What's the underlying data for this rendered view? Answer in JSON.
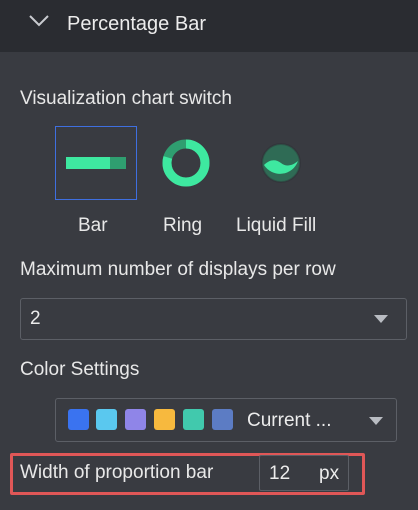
{
  "header": {
    "title": "Percentage Bar",
    "collapse_icon": "chevron-down-icon"
  },
  "chart_switch": {
    "label": "Visualization chart switch",
    "options": [
      {
        "label": "Bar",
        "icon": "bar-chart-icon",
        "selected": true
      },
      {
        "label": "Ring",
        "icon": "ring-chart-icon",
        "selected": false
      },
      {
        "label": "Liquid Fill",
        "icon": "liquid-fill-icon",
        "selected": false
      }
    ]
  },
  "max_displays": {
    "label": "Maximum number of displays per row",
    "value": "2"
  },
  "color_settings": {
    "label": "Color Settings",
    "palette": [
      "#3a73f0",
      "#5ac8ef",
      "#8f85e8",
      "#f7b93e",
      "#41c9ad",
      "#5c7cc4"
    ],
    "selected_value": "Current ..."
  },
  "bar_width": {
    "label": "Width of proportion bar",
    "value": "12",
    "unit": "px"
  },
  "colors": {
    "accent_green": "#3ee8a0",
    "selection_border": "#3f6fe0",
    "highlight_red": "#e05757"
  }
}
